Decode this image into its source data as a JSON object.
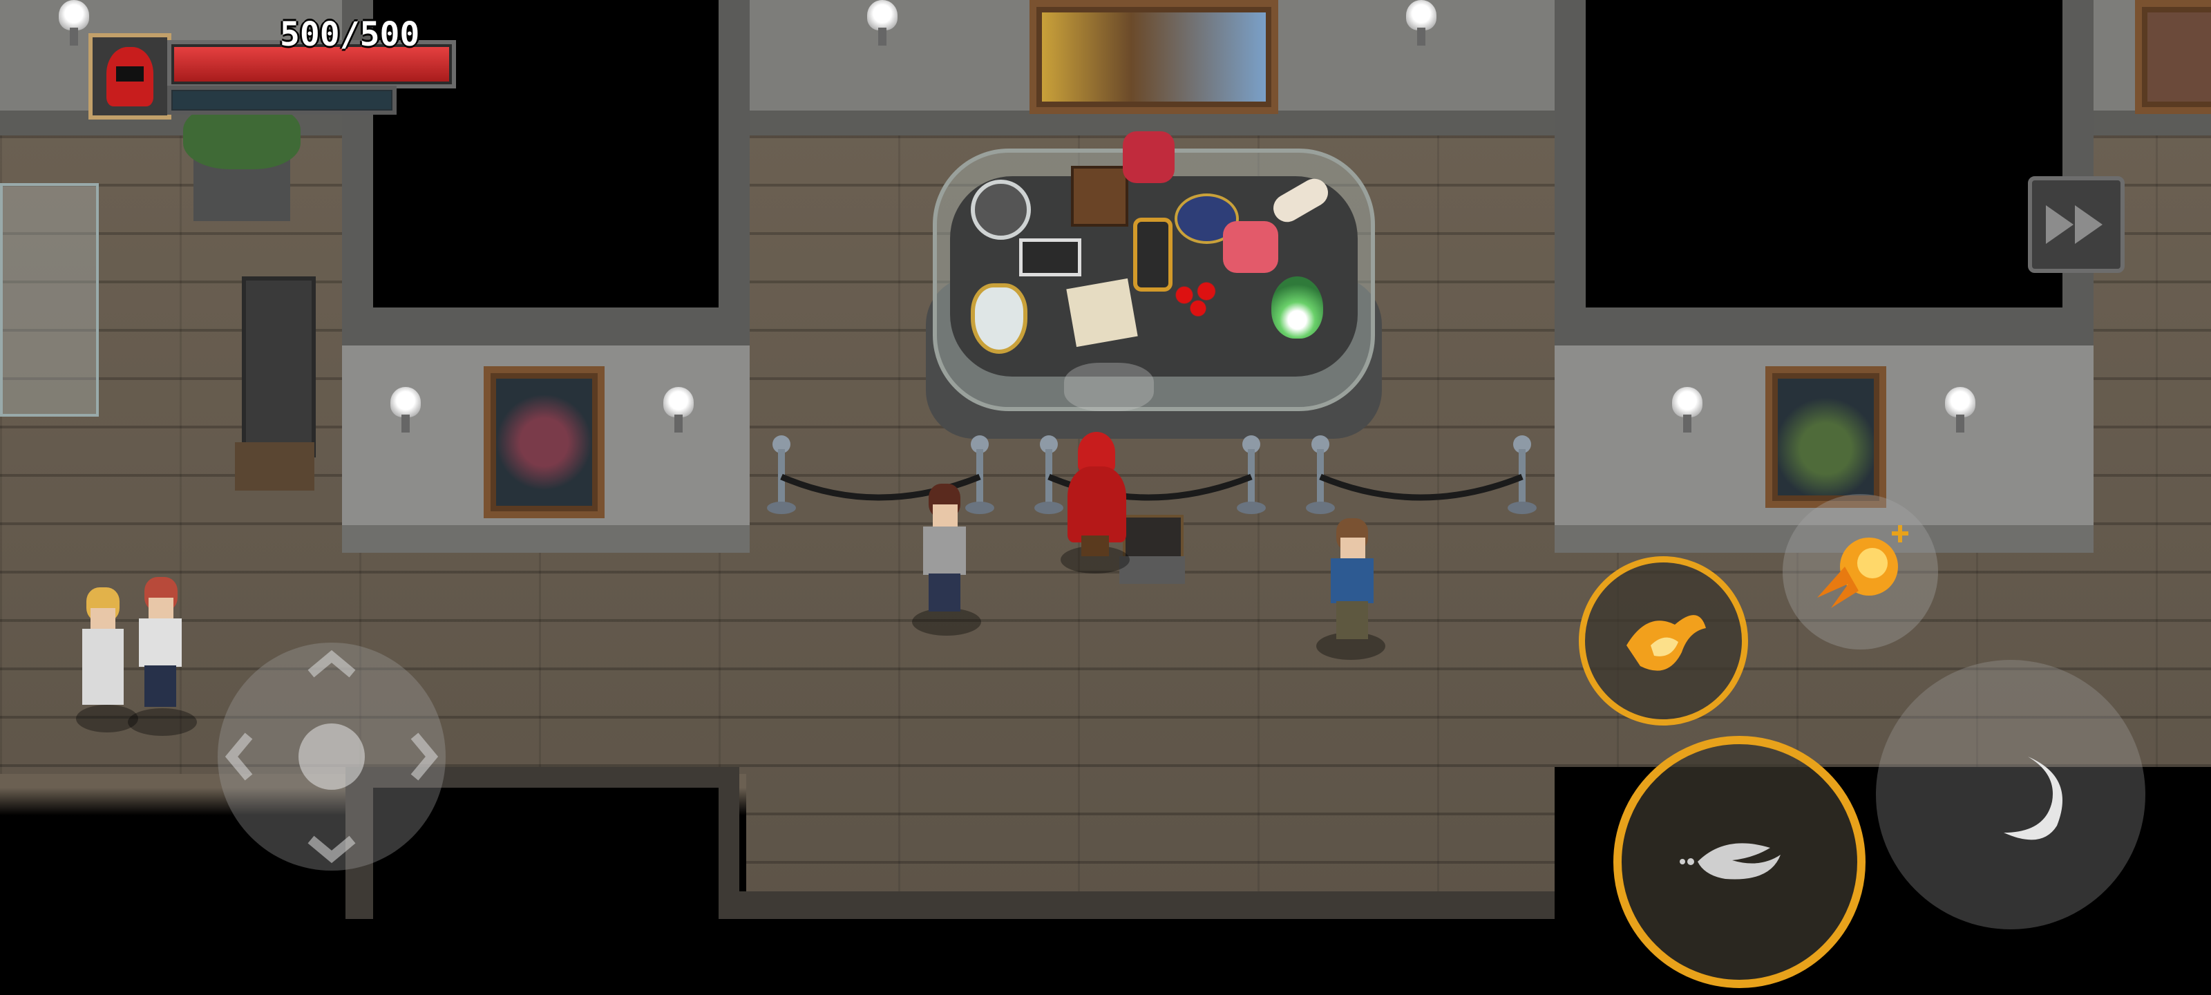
{
  "hud": {
    "health_text": "500/500",
    "health_fraction": 1.0,
    "mana_fraction": 1.0,
    "portrait_icon": "red-hooded-wizard-portrait"
  },
  "controls": {
    "fast_forward_icon": "fast-forward-icon",
    "joystick_icon": "dpad-joystick-icon",
    "signature_skill_icon": "fire-dragon-skill-icon",
    "dash_skill_icon": "fireball-skill-icon",
    "basic_attack_icon": "wind-slash-attack-icon",
    "dodge_icon": "crescent-dodge-icon"
  },
  "colors": {
    "health": "#d42a2a",
    "skill_ring": "#e8a21b",
    "player_cloak": "#c81d1d"
  },
  "scene": {
    "exhibit_items": [
      "shield-relic-icon",
      "treasure-chest-icon",
      "red-armor-icon",
      "blue-fish-icon",
      "scroll-icon",
      "tag-relic-icon",
      "battery-relic-icon",
      "pink-crystal-icon",
      "mirror-relic-icon",
      "parchment-icon",
      "red-berries-icon",
      "green-flame-icon"
    ]
  }
}
